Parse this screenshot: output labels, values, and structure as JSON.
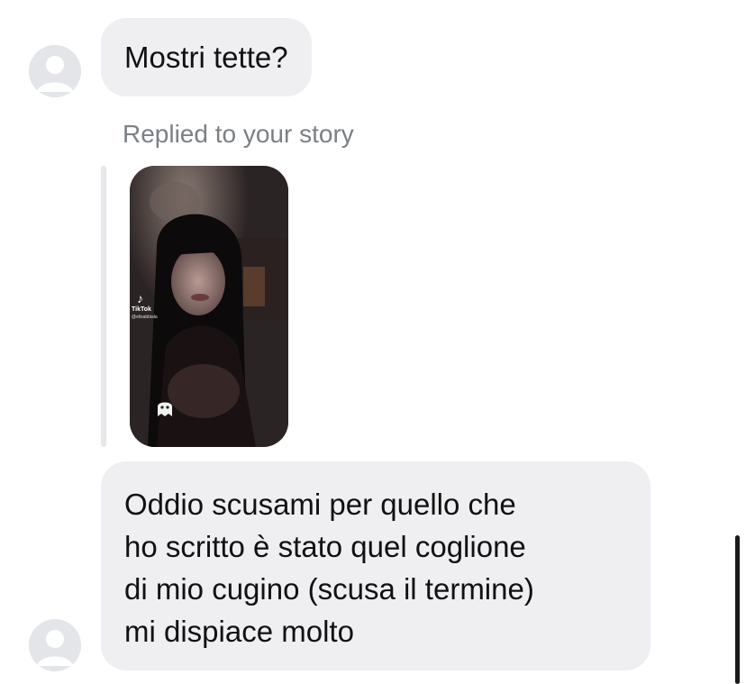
{
  "messages": {
    "first": {
      "text": "Mostri tette?"
    },
    "reply_label": "Replied to your story",
    "story": {
      "tiktok_label": "TikTok",
      "tiktok_user": "@elisabbiala"
    },
    "second": {
      "lines": [
        "Oddio scusami per quello che",
        "ho scritto è stato quel coglione",
        "di mio cugino (scusa il termine)",
        "mi dispiace molto"
      ]
    }
  },
  "icons": {
    "avatar": "default-avatar-icon",
    "tiktok": "tiktok-note-icon",
    "story_sticker": "ghost-sticker-icon"
  },
  "colors": {
    "bubble_bg": "#efeff2",
    "reply_label": "#7b7f86",
    "avatar_bg": "#e3e5e8"
  }
}
